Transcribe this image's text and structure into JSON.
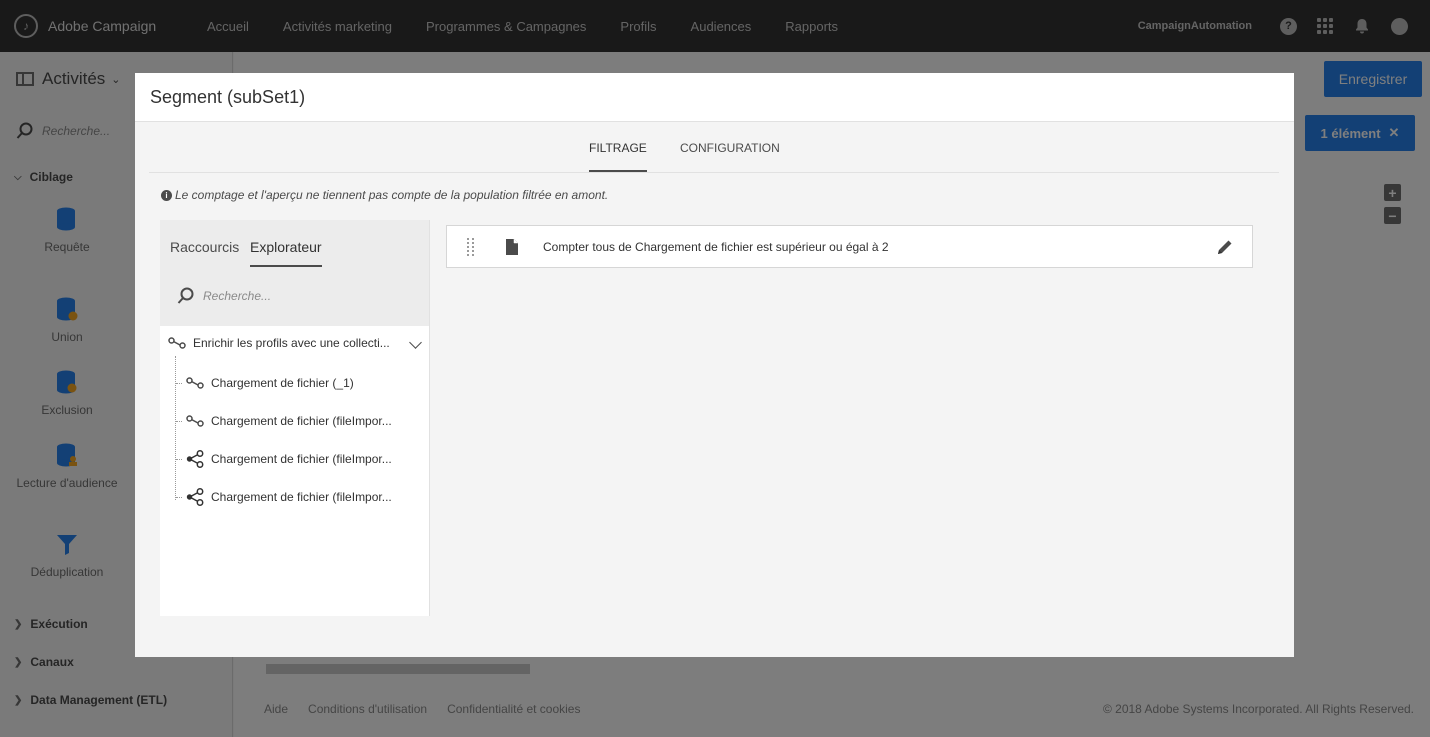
{
  "topbar": {
    "brand": "Adobe Campaign",
    "nav": [
      "Accueil",
      "Activités marketing",
      "Programmes & Campagnes",
      "Profils",
      "Audiences",
      "Rapports"
    ],
    "org": "CampaignAutomation",
    "help_glyph": "?",
    "icons": [
      "help-icon",
      "apps-icon",
      "bell-icon",
      "avatar"
    ]
  },
  "left_panel": {
    "title": "Activités",
    "search_placeholder": "Recherche...",
    "sections": {
      "ciblage": "Ciblage",
      "execution": "Exécution",
      "canaux": "Canaux",
      "data_management": "Data Management (ETL)"
    },
    "activities": [
      "Requête",
      "Union",
      "Exclusion",
      "Lecture d'audience",
      "Déduplication"
    ]
  },
  "canvas": {
    "save_label": "Enregistrer",
    "selection_label": "1 élément",
    "zoom_in": "+",
    "zoom_out": "−"
  },
  "footer": {
    "links": [
      "Aide",
      "Conditions d'utilisation",
      "Confidentialité et cookies"
    ],
    "copyright": "© 2018 Adobe Systems Incorporated. All Rights Reserved."
  },
  "modal": {
    "title": "Segment (subSet1)",
    "tabs": [
      "FILTRAGE",
      "CONFIGURATION"
    ],
    "active_tab": "FILTRAGE",
    "notice": "Le comptage et l'aperçu ne tiennent pas compte de la population filtrée en amont.",
    "explorer": {
      "tabs": [
        "Raccourcis",
        "Explorateur"
      ],
      "active_tab": "Explorateur",
      "search_placeholder": "Recherche...",
      "root": "Enrichir les profils avec une collecti...",
      "items": [
        {
          "label": "Chargement de fichier (_1)",
          "icon": "link-icon"
        },
        {
          "label": "Chargement de fichier (fileImpor...",
          "icon": "link-icon"
        },
        {
          "label": "Chargement de fichier (fileImpor...",
          "icon": "share-icon"
        },
        {
          "label": "Chargement de fichier (fileImpor...",
          "icon": "share-icon"
        }
      ]
    },
    "condition": {
      "text": "Compter tous de Chargement de fichier est supérieur ou égal à 2"
    }
  },
  "colors": {
    "topbar": "#323232",
    "accent": "#2680eb",
    "overlay": "rgba(0,0,0,0.5)"
  }
}
